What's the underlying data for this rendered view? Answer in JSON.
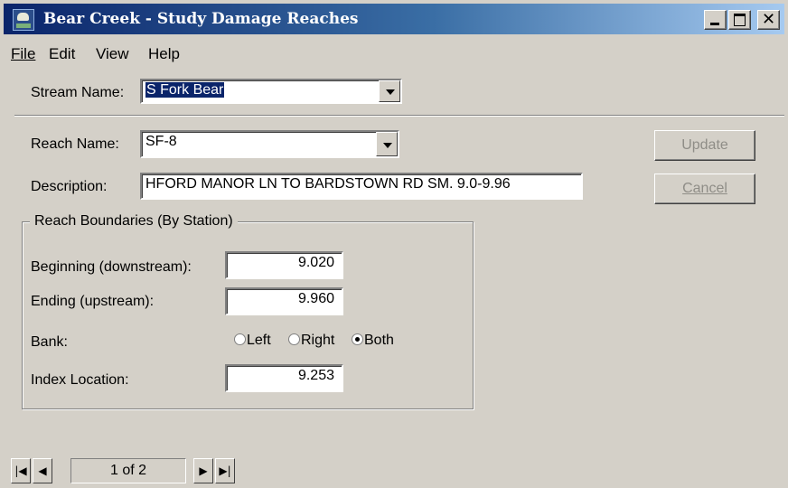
{
  "window": {
    "title": "Bear Creek - Study Damage Reaches"
  },
  "menu": {
    "file": "File",
    "edit": "Edit",
    "view": "View",
    "help": "Help"
  },
  "stream": {
    "label": "Stream Name:",
    "value": "S Fork Bear"
  },
  "reach": {
    "label": "Reach Name:",
    "value": "SF-8"
  },
  "description": {
    "label": "Description:",
    "value": "HFORD MANOR LN TO BARDSTOWN RD  SM. 9.0-9.96"
  },
  "buttons": {
    "update": "Update",
    "cancel": "Cancel"
  },
  "boundaries": {
    "legend": "Reach Boundaries (By Station)",
    "beginning_label": "Beginning (downstream):",
    "beginning_value": "9.020",
    "ending_label": "Ending (upstream):",
    "ending_value": "9.960",
    "bank_label": "Bank:",
    "bank_options": [
      "Left",
      "Right",
      "Both"
    ],
    "bank_selected": "Both",
    "index_label": "Index Location:",
    "index_value": "9.253"
  },
  "navigator": {
    "position": "1 of 2"
  },
  "icons": {
    "first": "first-record-icon",
    "prev": "previous-record-icon",
    "next": "next-record-icon",
    "last": "last-record-icon"
  },
  "colors": {
    "titlebar_start": "#0a246a",
    "titlebar_end": "#a6caf0",
    "face": "#d4d0c8"
  }
}
